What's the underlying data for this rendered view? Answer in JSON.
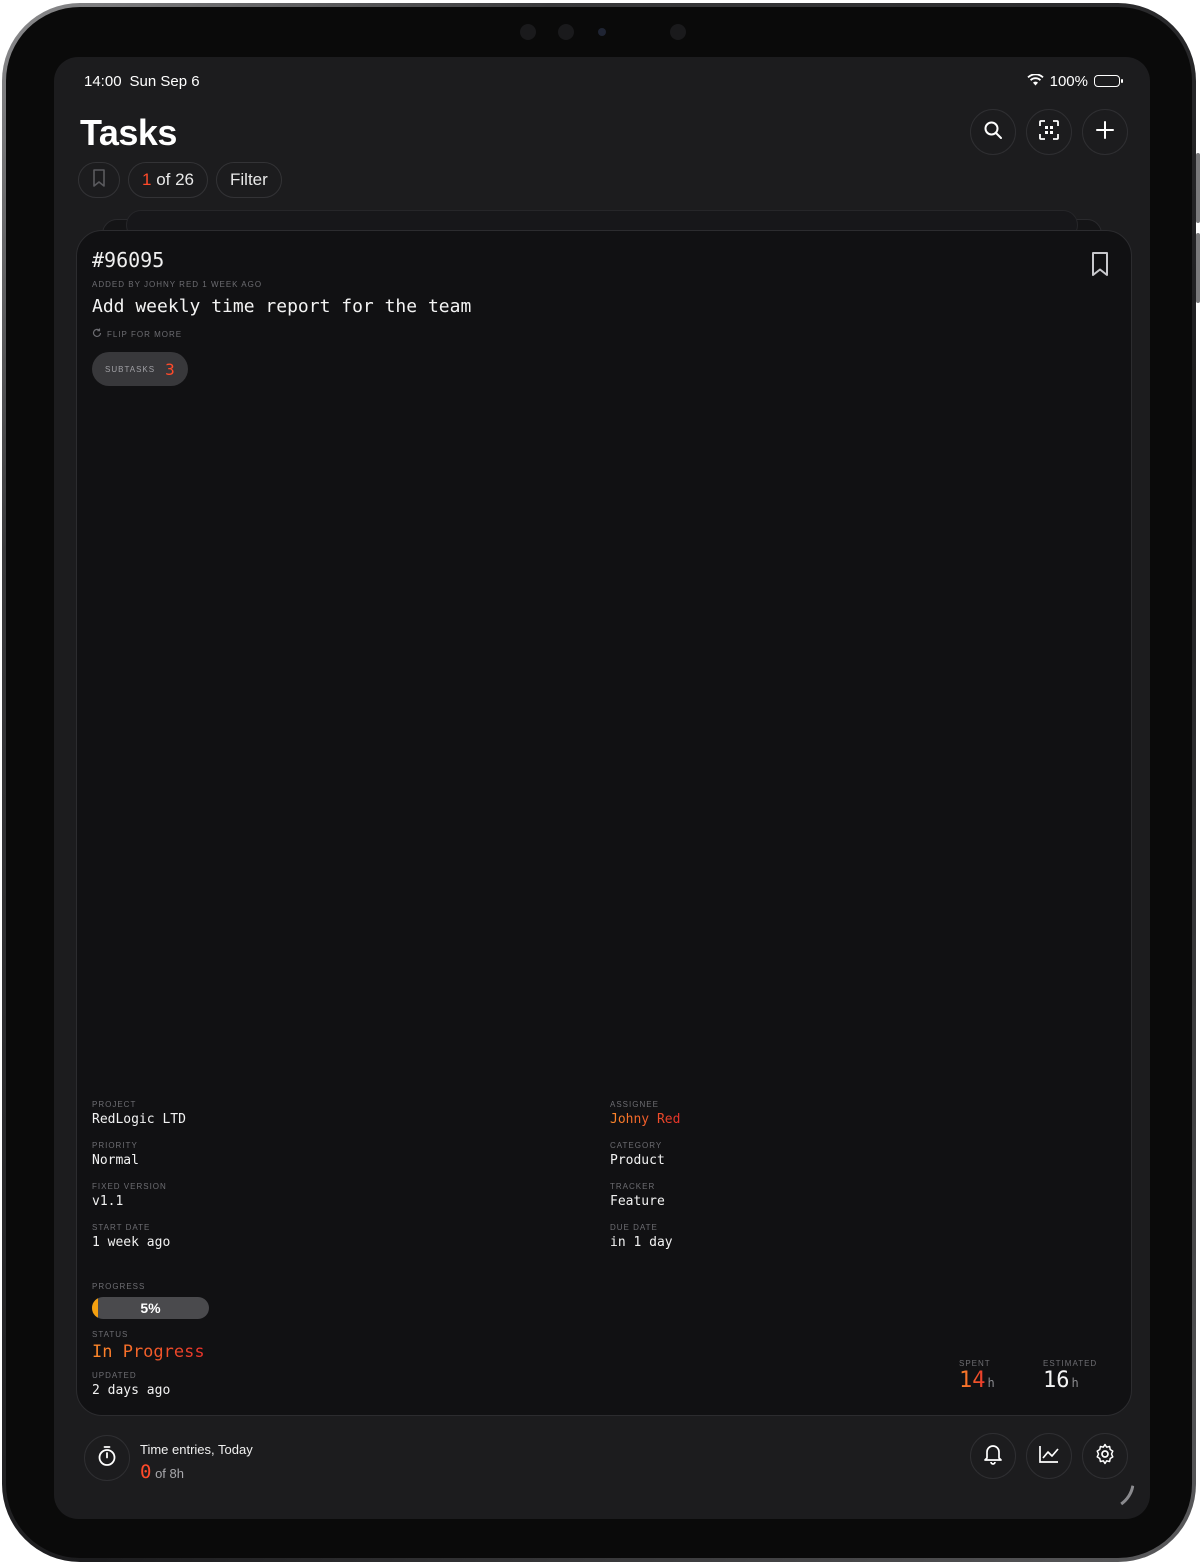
{
  "status_bar": {
    "time": "14:00",
    "date": "Sun Sep 6",
    "battery": "100%"
  },
  "header": {
    "title": "Tasks",
    "icons": {
      "search": "search-icon",
      "scan": "qr-scan-icon",
      "add": "plus-icon"
    }
  },
  "filters": {
    "bookmark_icon": "bookmark-icon",
    "position_current": "1",
    "position_rest": " of 26",
    "filter_label": "Filter"
  },
  "task": {
    "id": "#96095",
    "added_by": "ADDED BY JOHNY RED 1 WEEK AGO",
    "title": "Add weekly time report for the team",
    "flip_hint": "FLIP FOR MORE",
    "subtasks_label": "SUBTASKS",
    "subtasks_count": "3",
    "details": {
      "project_label": "PROJECT",
      "project": "RedLogic LTD",
      "assignee_label": "ASSIGNEE",
      "assignee": "Johny Red",
      "priority_label": "PRIORITY",
      "priority": "Normal",
      "category_label": "CATEGORY",
      "category": "Product",
      "fixed_version_label": "FIXED VERSION",
      "fixed_version": "v1.1",
      "tracker_label": "TRACKER",
      "tracker": "Feature",
      "start_date_label": "START DATE",
      "start_date": "1 week ago",
      "due_date_label": "DUE DATE",
      "due_date": "in 1 day"
    },
    "progress_label": "PROGRESS",
    "progress_text": "5%",
    "progress_value": 0.05,
    "status_label": "STATUS",
    "status": "In Progress",
    "updated_label": "UPDATED",
    "updated": "2 days ago",
    "spent_label": "SPENT",
    "spent": "14",
    "estimated_label": "ESTIMATED",
    "estimated": "16",
    "hours_unit": "h"
  },
  "footer": {
    "time_entries_label": "Time entries, Today",
    "time_entries_value": "0",
    "time_entries_total": " of 8h",
    "icons": {
      "timer": "stopwatch-icon",
      "notifications": "bell-icon",
      "stats": "chart-icon",
      "settings": "gear-icon"
    }
  },
  "colors": {
    "accent": "#ff4a2a",
    "progress": "#f4a010",
    "background": "#1c1c1e",
    "card": "#111113"
  }
}
